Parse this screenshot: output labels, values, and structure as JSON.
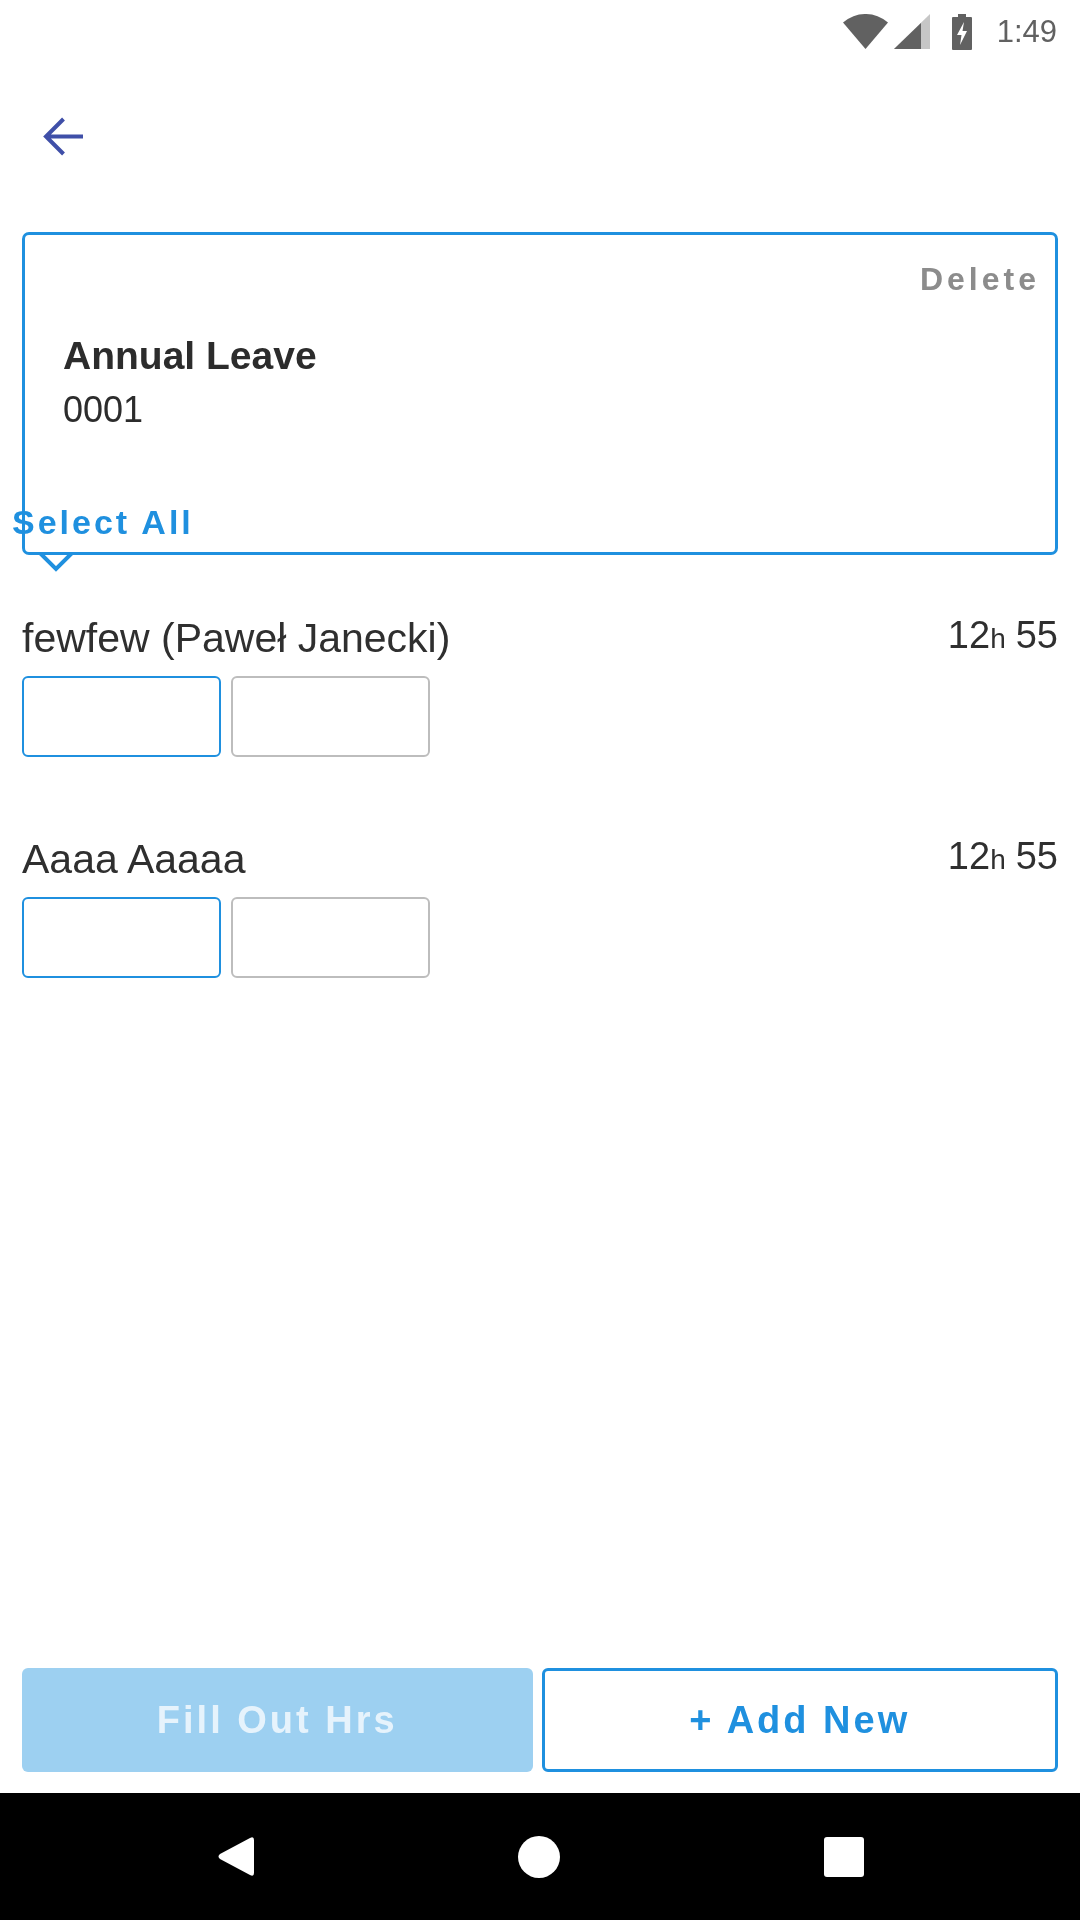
{
  "status_bar": {
    "time": "1:49"
  },
  "leave_card": {
    "action": "Delete",
    "title": "Annual Leave",
    "code": "0001",
    "select_all": "Select All"
  },
  "employees": [
    {
      "name": "fewfew (Paweł Janecki)",
      "duration": {
        "hours": "12",
        "unit": "h",
        "minutes": "55"
      },
      "fields": [
        {
          "focused": true
        },
        {
          "focused": false
        }
      ]
    },
    {
      "name": "Aaaa Aaaaa",
      "duration": {
        "hours": "12",
        "unit": "h",
        "minutes": "55"
      },
      "fields": [
        {
          "focused": true
        },
        {
          "focused": false
        }
      ]
    }
  ],
  "buttons": [
    {
      "label": "Fill Out Hrs",
      "kind": "filled",
      "disabled": true
    },
    {
      "label": "+ Add New",
      "kind": "outlined",
      "disabled": false
    }
  ]
}
